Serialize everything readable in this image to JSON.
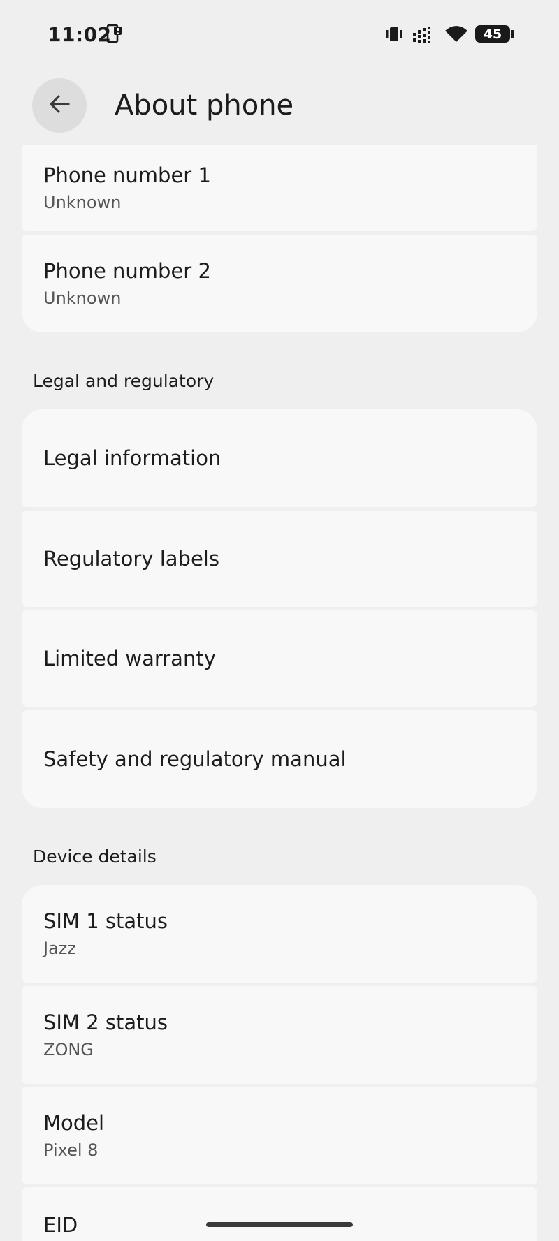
{
  "status_bar": {
    "time": "11:02",
    "battery": "45"
  },
  "header": {
    "title": "About phone"
  },
  "top_items": [
    {
      "title": "Phone number 1",
      "subtitle": "Unknown"
    },
    {
      "title": "Phone number 2",
      "subtitle": "Unknown"
    }
  ],
  "legal": {
    "header": "Legal and regulatory",
    "items": [
      {
        "title": "Legal information"
      },
      {
        "title": "Regulatory labels"
      },
      {
        "title": "Limited warranty"
      },
      {
        "title": "Safety and regulatory manual"
      }
    ]
  },
  "device": {
    "header": "Device details",
    "items": [
      {
        "title": "SIM 1 status",
        "subtitle": "Jazz"
      },
      {
        "title": "SIM 2 status",
        "subtitle": "ZONG"
      },
      {
        "title": "Model",
        "subtitle": "Pixel 8"
      },
      {
        "title": "EID"
      }
    ]
  },
  "colors": {
    "background": "#efefef",
    "card": "#f8f8f8",
    "back_button": "#dddddd"
  },
  "icons": [
    "portrait-phone-icon",
    "vibrate-icon",
    "signal-icon",
    "wifi-icon",
    "battery-icon",
    "back-arrow-icon"
  ]
}
